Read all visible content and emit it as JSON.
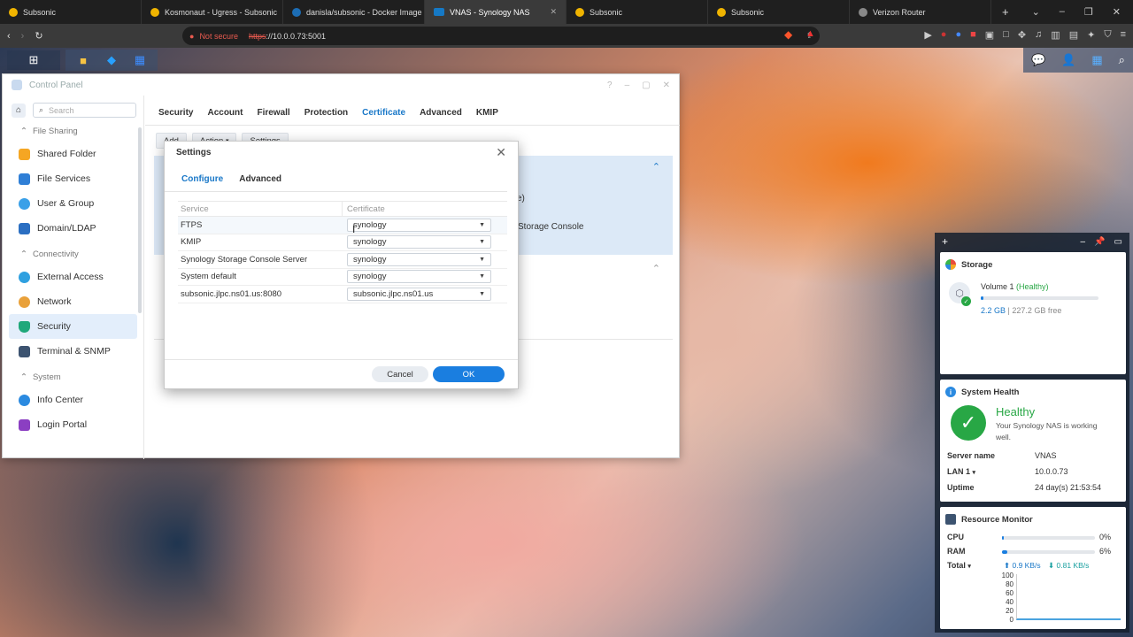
{
  "browser": {
    "tabs": [
      {
        "title": "Subsonic",
        "icon": "subsonic-icon",
        "active": false
      },
      {
        "title": "Kosmonaut - Ugress - Subsonic",
        "icon": "subsonic-icon",
        "active": false
      },
      {
        "title": "danisla/subsonic - Docker Image | D",
        "icon": "github-icon",
        "active": false
      },
      {
        "title": "VNAS - Synology NAS",
        "icon": "dsm-icon",
        "active": true
      },
      {
        "title": "Subsonic",
        "icon": "subsonic-icon",
        "active": false
      },
      {
        "title": "Subsonic",
        "icon": "subsonic-icon",
        "active": false
      },
      {
        "title": "Verizon Router",
        "icon": "router-icon",
        "active": false
      }
    ],
    "security_label": "Not secure",
    "url_scheme": "https",
    "url_rest": "://10.0.0.73:5001"
  },
  "control_panel": {
    "title": "Control Panel",
    "search_placeholder": "Search",
    "groups": {
      "file_sharing": "File Sharing",
      "connectivity": "Connectivity",
      "system": "System"
    },
    "items": {
      "shared_folder": "Shared Folder",
      "file_services": "File Services",
      "user_group": "User & Group",
      "domain_ldap": "Domain/LDAP",
      "external_access": "External Access",
      "network": "Network",
      "security": "Security",
      "terminal_snmp": "Terminal & SNMP",
      "info_center": "Info Center",
      "login_portal": "Login Portal"
    },
    "tabs": [
      "Security",
      "Account",
      "Firewall",
      "Protection",
      "Certificate",
      "Advanced",
      "KMIP"
    ],
    "active_tab": "Certificate",
    "toolbar": {
      "add": "Add",
      "action": "Action",
      "settings": "Settings"
    },
    "background_text": {
      "line1": "e)",
      "line2": "Storage Console"
    }
  },
  "settings_dialog": {
    "title": "Settings",
    "tabs": {
      "configure": "Configure",
      "advanced": "Advanced"
    },
    "columns": {
      "service": "Service",
      "certificate": "Certificate"
    },
    "rows": [
      {
        "service": "FTPS",
        "certificate": "synology"
      },
      {
        "service": "KMIP",
        "certificate": "synology"
      },
      {
        "service": "Synology Storage Console Server",
        "certificate": "synology"
      },
      {
        "service": "System default",
        "certificate": "synology"
      },
      {
        "service": "subsonic.jlpc.ns01.us:8080",
        "certificate": "subsonic.jlpc.ns01.us"
      }
    ],
    "cancel": "Cancel",
    "ok": "OK"
  },
  "widgets": {
    "storage": {
      "title": "Storage",
      "volume": "Volume 1",
      "status": "(Healthy)",
      "used": "2.2 GB",
      "free": "227.2 GB free",
      "used_fraction": 0.01
    },
    "health": {
      "title": "System Health",
      "status": "Healthy",
      "message": "Your Synology NAS is working well.",
      "server_name_label": "Server name",
      "server_name": "VNAS",
      "lan_label": "LAN 1",
      "lan": "10.0.0.73",
      "uptime_label": "Uptime",
      "uptime": "24 day(s) 21:53:54"
    },
    "resource": {
      "title": "Resource Monitor",
      "cpu_label": "CPU",
      "cpu": "0%",
      "cpu_fraction": 0.0,
      "ram_label": "RAM",
      "ram": "6%",
      "ram_fraction": 0.06,
      "total_label": "Total",
      "upload": "0.9 KB/s",
      "download": "0.81 KB/s",
      "y_ticks": [
        "100",
        "80",
        "60",
        "40",
        "20",
        "0"
      ]
    }
  },
  "colors": {
    "accent": "#1a78c8",
    "healthy": "#28a745",
    "ok_button": "#1a7ee0"
  }
}
